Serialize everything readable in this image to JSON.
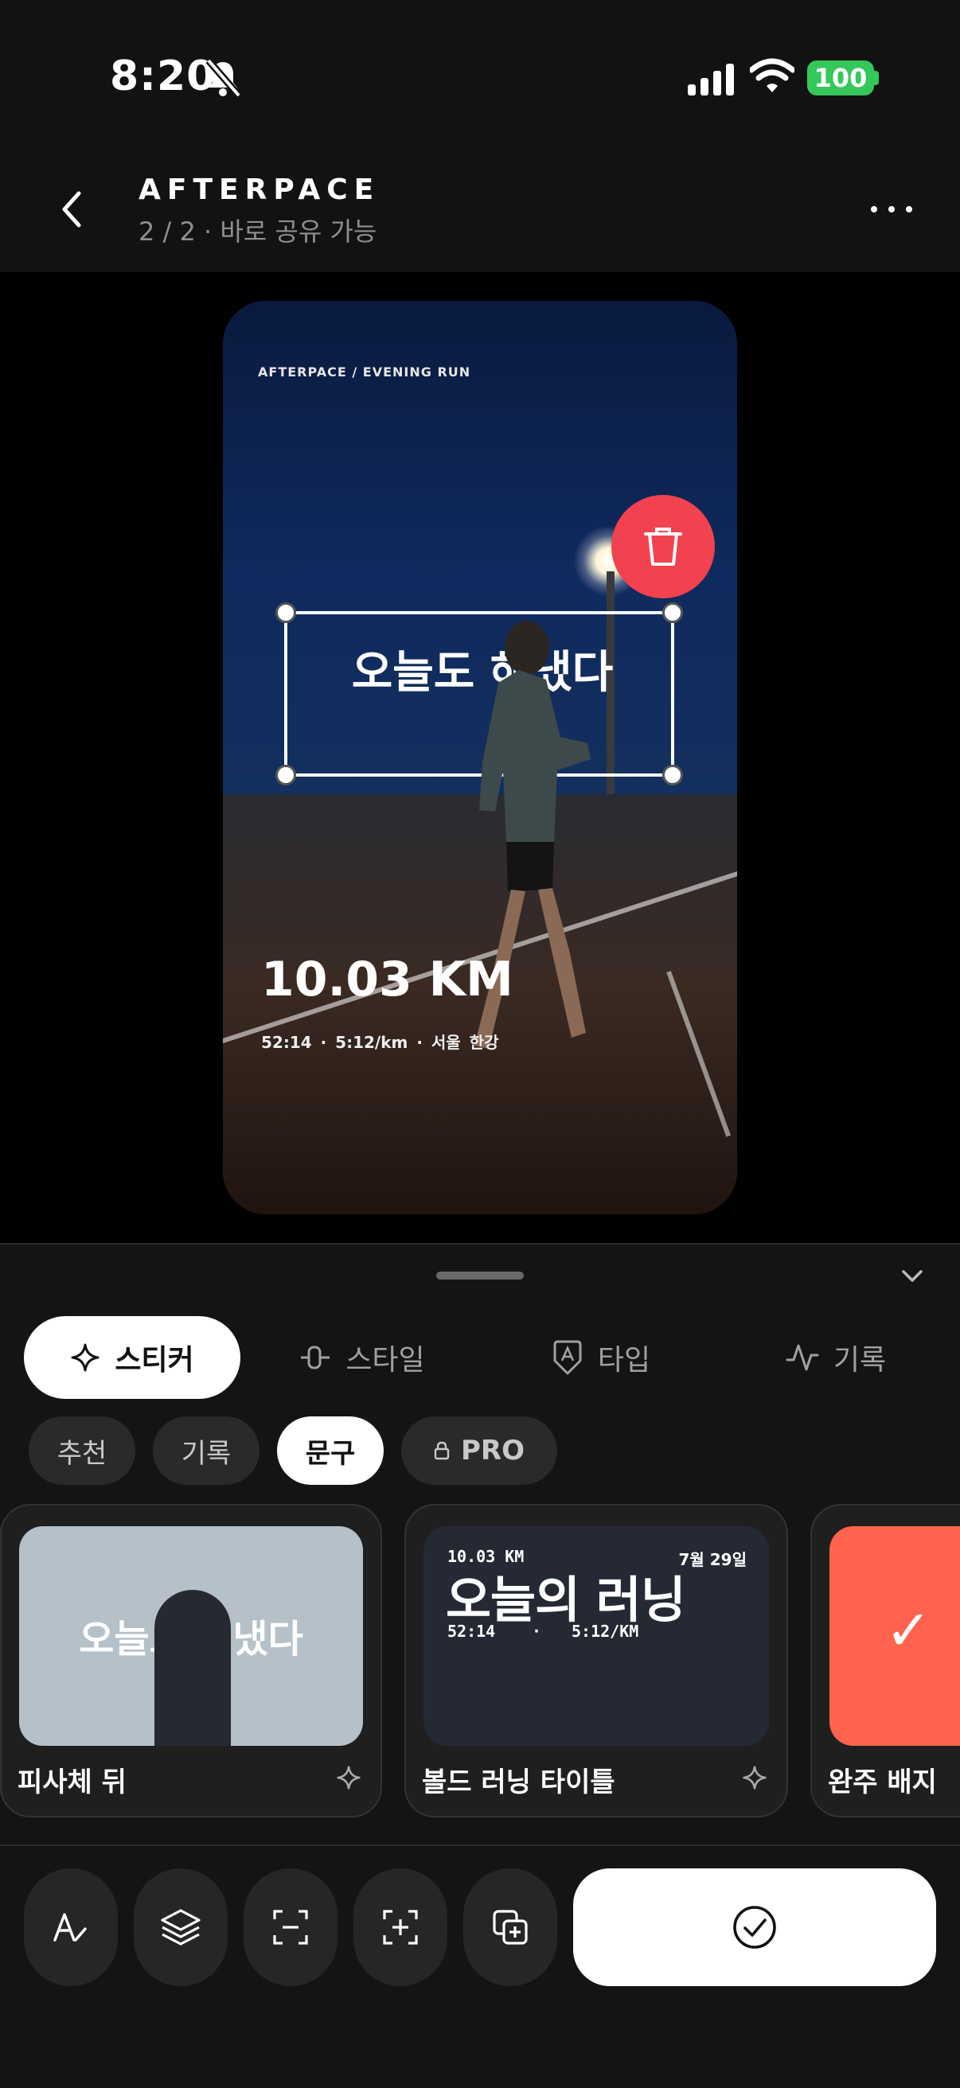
{
  "status_bar": {
    "time": "8:20",
    "battery": "100"
  },
  "header": {
    "title": "AFTERPACE",
    "subtitle": "2 / 2 · 바로 공유 가능"
  },
  "canvas": {
    "brand_line": "AFTERPACE  /  EVENING RUN",
    "sticker_text": "오늘도 해냈다",
    "distance": "10.03 KM",
    "meta": "52:14  ·  5:12/km  ·  서울 한강"
  },
  "tabs": [
    {
      "label": "스티커",
      "icon": "sparkle-icon",
      "active": true
    },
    {
      "label": "스타일",
      "icon": "slider-icon"
    },
    {
      "label": "타입",
      "icon": "font-tag-icon"
    },
    {
      "label": "기록",
      "icon": "activity-icon"
    }
  ],
  "filters": [
    {
      "label": "추천"
    },
    {
      "label": "기록"
    },
    {
      "label": "문구",
      "active": true
    },
    {
      "label": "PRO",
      "icon": "lock-icon"
    }
  ],
  "stickers": [
    {
      "label": "피사체 뒤",
      "preview_text": "오늘도 해냈다"
    },
    {
      "label": "볼드 러닝 타이틀",
      "preview_km": "10.03 KM",
      "preview_date": "7월 29일",
      "preview_title": "오늘의 러닝",
      "preview_time": "52:14",
      "preview_sep": "·",
      "preview_pace": "5:12/KM"
    },
    {
      "label": "완주 배지",
      "preview_mark": "✓"
    }
  ],
  "colors": {
    "accent_red": "#f2424f",
    "badge_orange": "#ff634d",
    "battery_green": "#35c759"
  }
}
